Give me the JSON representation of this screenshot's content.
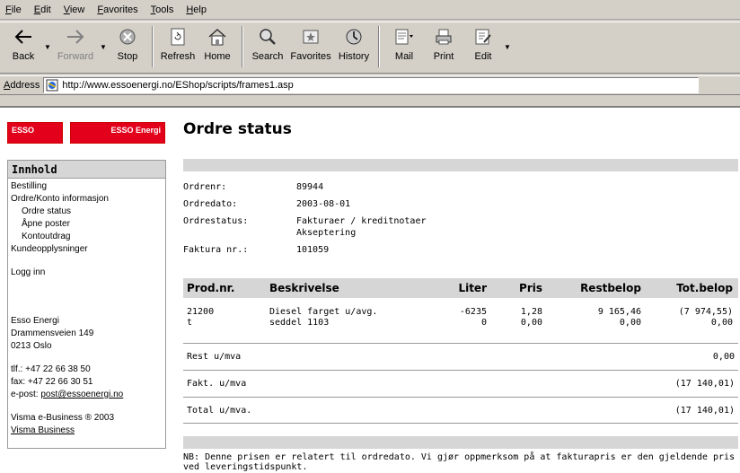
{
  "menu": [
    "File",
    "Edit",
    "View",
    "Favorites",
    "Tools",
    "Help"
  ],
  "toolbar": {
    "back": "Back",
    "forward": "Forward",
    "stop": "Stop",
    "refresh": "Refresh",
    "home": "Home",
    "search": "Search",
    "favorites": "Favorites",
    "history": "History",
    "mail": "Mail",
    "print": "Print",
    "edit": "Edit"
  },
  "address": {
    "label": "Address",
    "url": "http://www.essoenergi.no/EShop/scripts/frames1.asp"
  },
  "logo": {
    "left": "ESSO",
    "right": "ESSO Energi"
  },
  "sidebar": {
    "heading": "Innhold",
    "items": [
      "Bestilling",
      "Ordre/Konto informasjon",
      "Ordre status",
      "Åpne poster",
      "Kontoutdrag",
      "Kundeopplysninger",
      "Logg inn"
    ],
    "company": [
      "Esso Energi",
      "Drammensveien 149",
      "0213 Oslo"
    ],
    "tlf": "tlf.: +47 22 66 38 50",
    "fax": "fax: +47 22 66 30 51",
    "email_prefix": "e-post: ",
    "email": "post@essoenergi.no",
    "copyright": "Visma e-Business ® 2003",
    "visma_link": "Visma Business"
  },
  "main": {
    "title": "Ordre status",
    "info": {
      "ordrenr_label": "Ordrenr:",
      "ordrenr": "89944",
      "ordredato_label": "Ordredato:",
      "ordredato": "2003-08-01",
      "ordrestatus_label": "Ordrestatus:",
      "ordrestatus_1": "Fakturaer / kreditnotaer",
      "ordrestatus_2": "Akseptering",
      "faktura_label": "Faktura nr.:",
      "faktura": "101059"
    },
    "table": {
      "headers": [
        "Prod.nr.",
        "Beskrivelse",
        "Liter",
        "Pris",
        "Restbelop",
        "Tot.belop"
      ],
      "rows": [
        [
          "21200",
          "Diesel farget u/avg.",
          "-6235",
          "1,28",
          "9 165,46",
          "(7 974,55)"
        ],
        [
          "t",
          "seddel 1103",
          "0",
          "0,00",
          "0,00",
          "0,00"
        ]
      ]
    },
    "summary": [
      {
        "label": "Rest u/mva",
        "value": "0,00"
      },
      {
        "label": "Fakt. u/mva",
        "value": "(17 140,01)"
      },
      {
        "label": "Total u/mva.",
        "value": "(17 140,01)"
      }
    ],
    "note": "NB: Denne prisen er relatert til ordredato. Vi gjør oppmerksom på at fakturapris er den gjeldende pris ved leveringstidspunkt."
  }
}
